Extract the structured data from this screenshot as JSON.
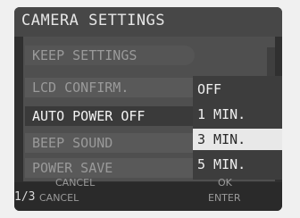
{
  "title": "CAMERA SETTINGS",
  "menu": {
    "items": [
      {
        "label": "KEEP SETTINGS"
      },
      {
        "label": "LCD CONFIRM."
      },
      {
        "label": "AUTO POWER OFF"
      },
      {
        "label": "BEEP SOUND"
      },
      {
        "label": "POWER SAVE"
      }
    ],
    "selected": "AUTO POWER OFF"
  },
  "dropdown": {
    "options": [
      "OFF",
      "1 MIN.",
      "3 MIN.",
      "5 MIN."
    ],
    "selected": "3 MIN."
  },
  "footer": {
    "cancel_top": "CANCEL",
    "ok": "OK",
    "page": "1/3",
    "cancel_bottom": "CANCEL",
    "enter": "ENTER"
  }
}
